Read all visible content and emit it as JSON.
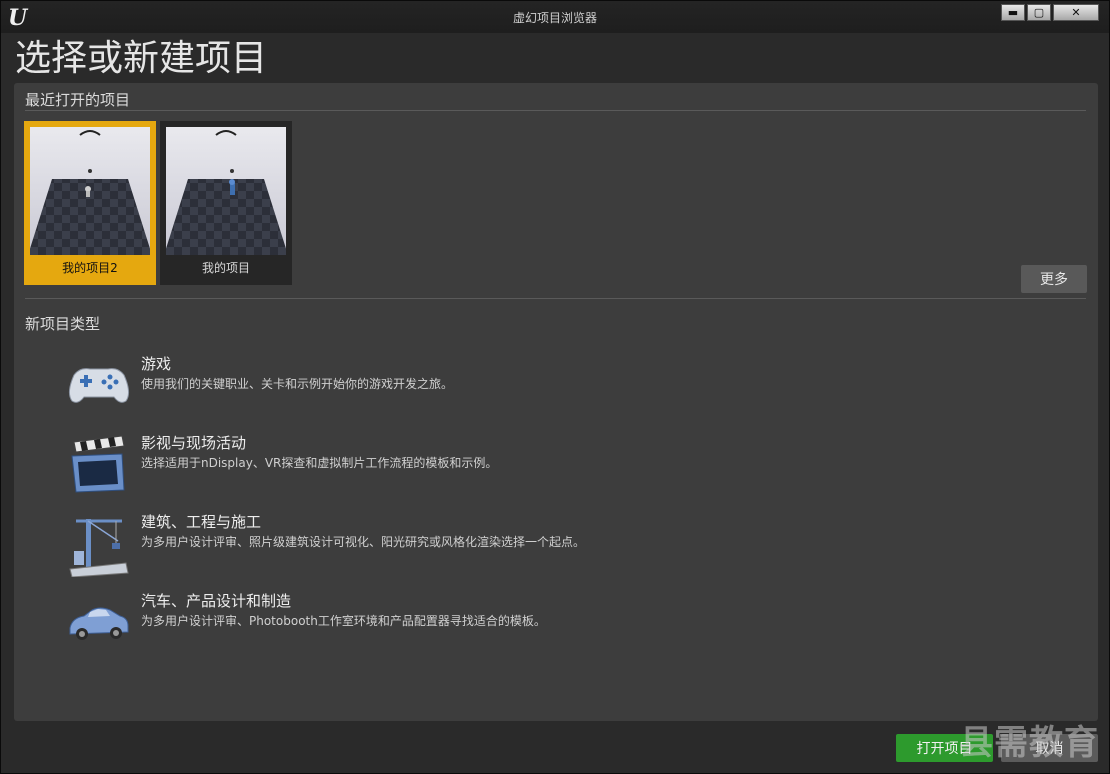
{
  "window": {
    "title": "虚幻项目浏览器",
    "minimize_label": "▬",
    "maximize_label": "▢",
    "close_label": "✕"
  },
  "page_title": "选择或新建项目",
  "recent": {
    "section_label": "最近打开的项目",
    "projects": [
      {
        "name": "我的项目2",
        "selected": true
      },
      {
        "name": "我的项目",
        "selected": false
      }
    ],
    "more_label": "更多"
  },
  "new_project": {
    "section_label": "新项目类型",
    "categories": [
      {
        "title": "游戏",
        "description": "使用我们的关键职业、关卡和示例开始你的游戏开发之旅。",
        "icon": "gamepad-icon"
      },
      {
        "title": "影视与现场活动",
        "description": "选择适用于nDisplay、VR探查和虚拟制片工作流程的模板和示例。",
        "icon": "clapperboard-icon"
      },
      {
        "title": "建筑、工程与施工",
        "description": "为多用户设计评审、照片级建筑设计可视化、阳光研究或风格化渲染选择一个起点。",
        "icon": "crane-icon"
      },
      {
        "title": "汽车、产品设计和制造",
        "description": "为多用户设计评审、Photobooth工作室环境和产品配置器寻找适合的模板。",
        "icon": "car-icon"
      }
    ]
  },
  "footer": {
    "open_label": "打开项目",
    "cancel_label": "取消"
  },
  "watermark": "县需教育",
  "colors": {
    "selected_highlight": "#e5a80f",
    "open_button": "#2d9a2d"
  }
}
